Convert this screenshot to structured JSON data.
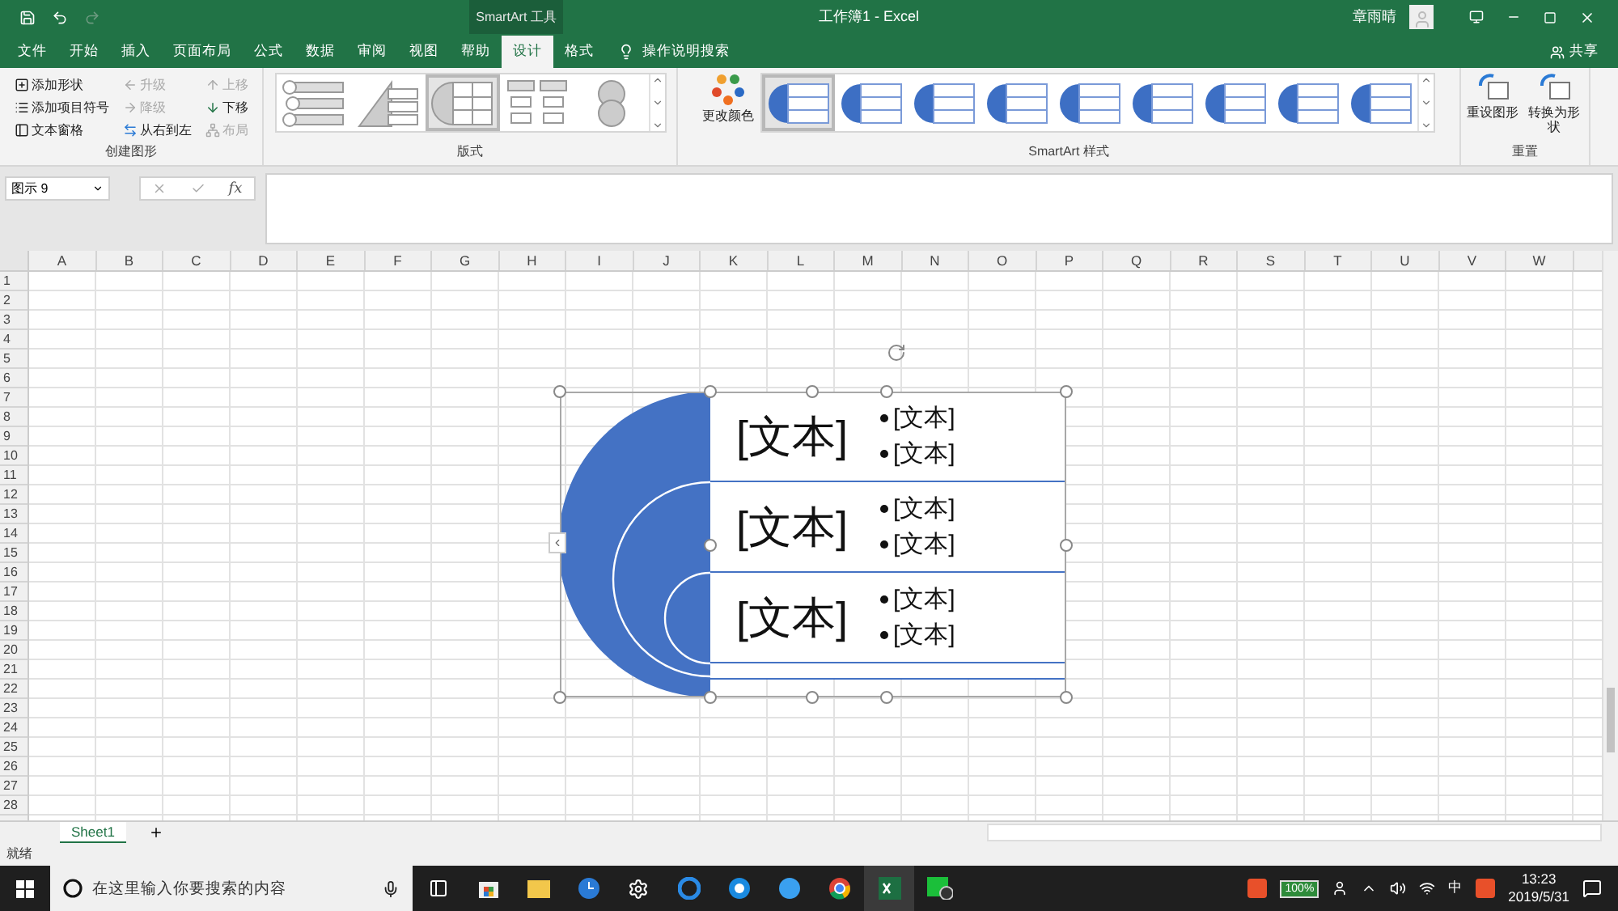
{
  "window": {
    "title": "工作簿1 - Excel",
    "context_group": "SmartArt 工具",
    "user": "章雨晴"
  },
  "ribbon_tabs": [
    {
      "label": "文件",
      "selected": false
    },
    {
      "label": "开始",
      "selected": false
    },
    {
      "label": "插入",
      "selected": false
    },
    {
      "label": "页面布局",
      "selected": false
    },
    {
      "label": "公式",
      "selected": false
    },
    {
      "label": "数据",
      "selected": false
    },
    {
      "label": "审阅",
      "selected": false
    },
    {
      "label": "视图",
      "selected": false
    },
    {
      "label": "帮助",
      "selected": false
    },
    {
      "label": "设计",
      "selected": true
    },
    {
      "label": "格式",
      "selected": false
    }
  ],
  "tell_me": "操作说明搜索",
  "share": "共享",
  "create_group": {
    "label": "创建图形",
    "items": [
      {
        "label": "添加形状",
        "kind": "add-shape",
        "disabled": false
      },
      {
        "label": "添加项目符号",
        "kind": "bullet",
        "disabled": false
      },
      {
        "label": "文本窗格",
        "kind": "pane",
        "disabled": false
      },
      {
        "label": "升级",
        "kind": "left",
        "disabled": true
      },
      {
        "label": "降级",
        "kind": "right",
        "disabled": true
      },
      {
        "label": "从右到左",
        "kind": "swap",
        "disabled": false
      },
      {
        "label": "上移",
        "kind": "up",
        "disabled": true
      },
      {
        "label": "下移",
        "kind": "down",
        "disabled": false
      },
      {
        "label": "布局",
        "kind": "layout",
        "disabled": true
      }
    ]
  },
  "layouts_group": {
    "label": "版式",
    "layouts": [
      {
        "kind": "circles",
        "selected": false
      },
      {
        "kind": "pyramid",
        "selected": false
      },
      {
        "kind": "arc",
        "selected": true
      },
      {
        "kind": "hierarchy",
        "selected": false
      },
      {
        "kind": "cycle",
        "selected": false
      }
    ]
  },
  "styles_group": {
    "label": "SmartArt 样式",
    "change_colors": "更改颜色",
    "styles": [
      {
        "selected": true
      },
      {
        "selected": false
      },
      {
        "selected": false
      },
      {
        "selected": false
      },
      {
        "selected": false
      },
      {
        "selected": false
      },
      {
        "selected": false
      },
      {
        "selected": false
      },
      {
        "selected": false
      }
    ]
  },
  "reset_group": {
    "label": "重置",
    "buttons": [
      "重设图形",
      "转换为形状"
    ]
  },
  "name_box": "图示 9",
  "insert_function": "fx",
  "columns": [
    "A",
    "B",
    "C",
    "D",
    "E",
    "F",
    "G",
    "H",
    "I",
    "J",
    "K",
    "L",
    "M",
    "N",
    "O",
    "P",
    "Q",
    "R",
    "S",
    "T",
    "U",
    "V",
    "W"
  ],
  "rows": [
    "1",
    "2",
    "3",
    "4",
    "5",
    "6",
    "7",
    "8",
    "9",
    "10",
    "11",
    "12",
    "13",
    "14",
    "15",
    "16",
    "17",
    "18",
    "19",
    "20",
    "21",
    "22",
    "23",
    "24",
    "25",
    "26",
    "27",
    "28"
  ],
  "smartart": {
    "items": [
      {
        "text": "[文本]",
        "bullets": [
          "[文本]",
          "[文本]"
        ]
      },
      {
        "text": "[文本]",
        "bullets": [
          "[文本]",
          "[文本]"
        ]
      },
      {
        "text": "[文本]",
        "bullets": [
          "[文本]",
          "[文本]"
        ]
      }
    ]
  },
  "sheet_tabs": [
    {
      "label": "Sheet1",
      "selected": true
    }
  ],
  "status": "就绪",
  "taskbar": {
    "search_placeholder": "在这里输入你要搜索的内容",
    "battery": "100%",
    "ime": "中",
    "time": "13:23",
    "date": "2019/5/31"
  }
}
